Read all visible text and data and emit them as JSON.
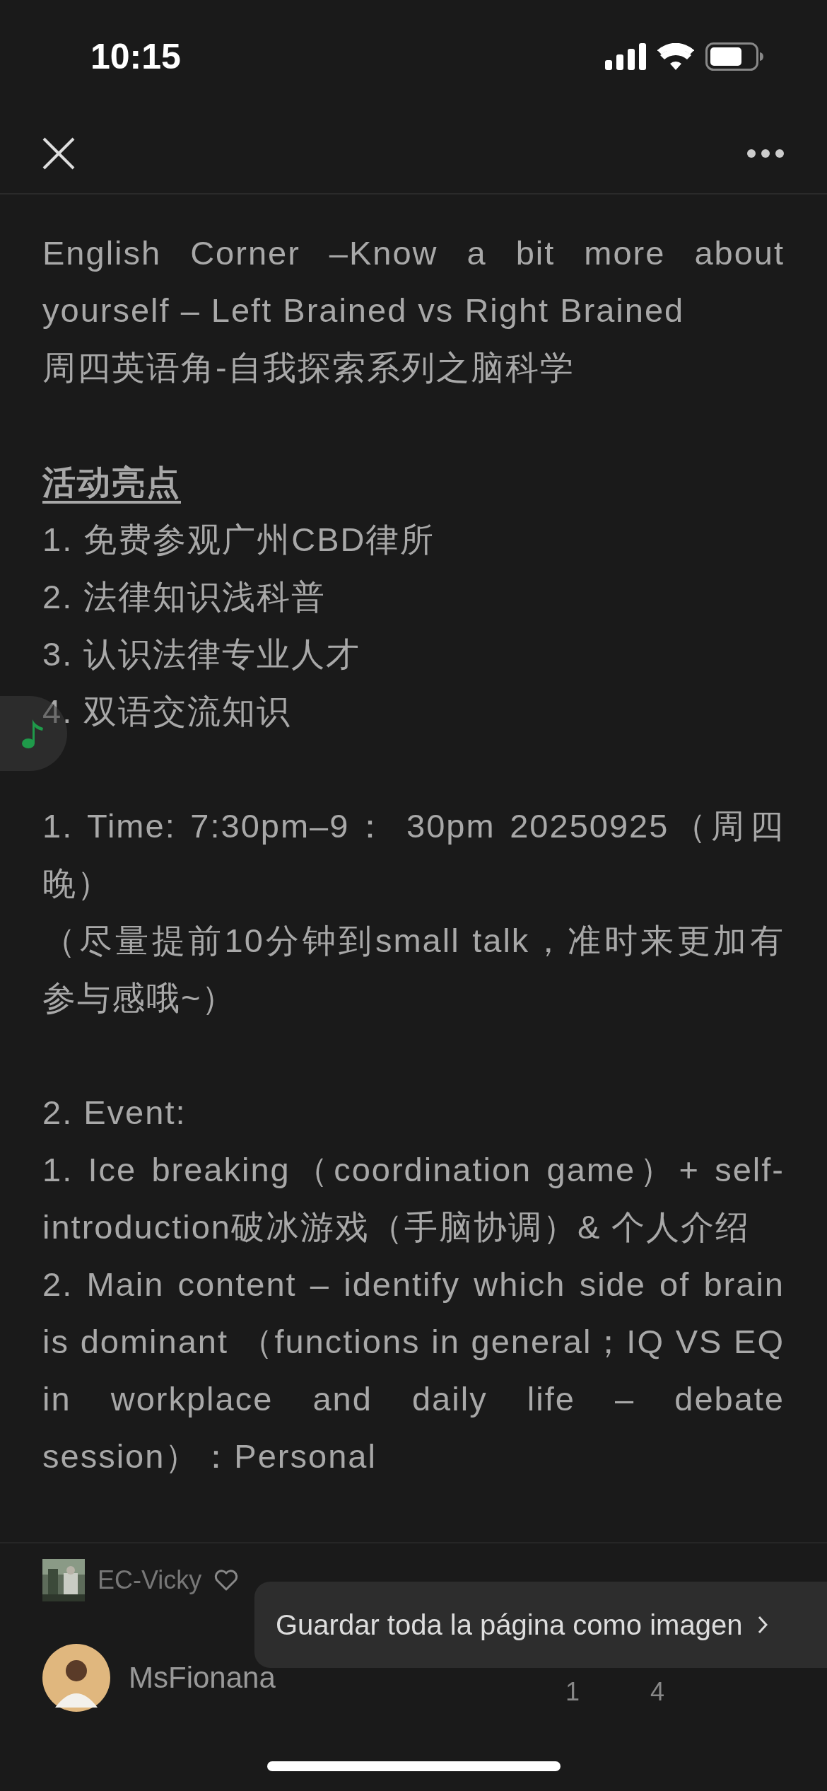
{
  "status_bar": {
    "time": "10:15"
  },
  "sections": [
    {
      "items": [
        {
          "kind": "text",
          "text": "English Corner –Know a bit more about yourself – Left Brained vs Right Brained"
        },
        {
          "kind": "text",
          "text": "周四英语角-自我探索系列之脑科学"
        }
      ]
    },
    {
      "items": [
        {
          "kind": "heading",
          "text": "活动亮点"
        },
        {
          "kind": "text",
          "text": "1. 免费参观广州CBD律所"
        },
        {
          "kind": "text",
          "text": "2. 法律知识浅科普"
        },
        {
          "kind": "text",
          "text": "3. 认识法律专业人才"
        },
        {
          "kind": "text",
          "text": "4. 双语交流知识"
        }
      ]
    },
    {
      "items": [
        {
          "kind": "text",
          "text": "1. Time: 7:30pm–9： 30pm  20250925（周四晚）"
        },
        {
          "kind": "text",
          "text": "（尽量提前10分钟到small talk，准时来更加有参与感哦~）"
        }
      ]
    },
    {
      "items": [
        {
          "kind": "text",
          "text": "2. Event:"
        },
        {
          "kind": "text",
          "text": "1. Ice breaking（coordination game）+ self-introduction破冰游戏（手脑协调）& 个人介绍"
        },
        {
          "kind": "text",
          "text": "2. Main content – identify which side of brain is dominant （functions in general；IQ VS EQ in workplace and daily life – debate session）：Personal"
        }
      ]
    }
  ],
  "footer": {
    "source": {
      "name": "EC-Vicky"
    },
    "author": {
      "name": "MsFionana"
    },
    "counts": [
      "1",
      "4"
    ]
  },
  "toast": {
    "label": "Guardar toda la página como imagen"
  }
}
